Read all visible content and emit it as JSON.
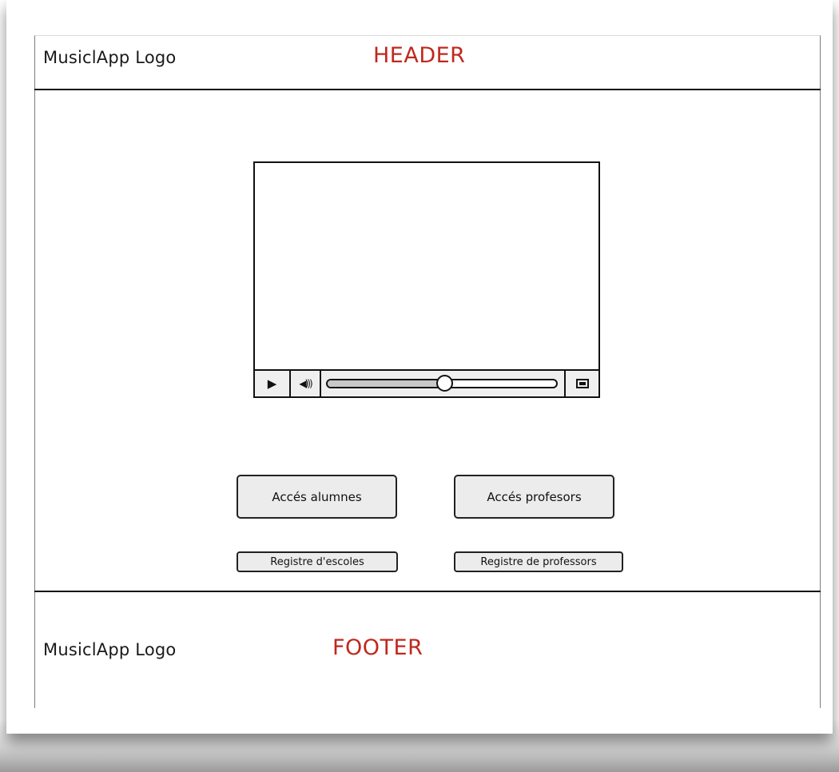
{
  "header": {
    "logo": "MusiclApp Logo",
    "label": "HEADER"
  },
  "video_player": {
    "play_icon": "▶",
    "volume_icon": "◀︎)))",
    "progress": 0.51,
    "fullscreen_icon": "fullscreen-icon"
  },
  "actions": {
    "access_students": "Accés alumnes",
    "access_teachers": "Accés profesors",
    "register_schools": "Registre d'escoles",
    "register_teachers": "Registre de professors"
  },
  "footer": {
    "logo": "MusiclApp Logo",
    "label": "FOOTER"
  },
  "colors": {
    "accent_red": "#c0281e",
    "button_bg": "#ececec"
  }
}
